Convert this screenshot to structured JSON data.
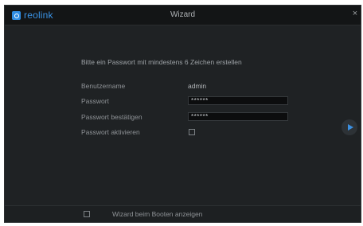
{
  "titlebar": {
    "logo_text": "reolink",
    "title": "Wizard",
    "close_symbol": "×"
  },
  "form": {
    "instruction": "Bitte ein Passwort mit mindestens 6 Zeichen erstellen",
    "username_label": "Benutzername",
    "username_value": "admin",
    "password_label": "Passwort",
    "password_value": "******",
    "confirm_label": "Passwort bestätigen",
    "confirm_value": "******",
    "enable_label": "Passwort aktivieren",
    "enable_checked": false
  },
  "footer": {
    "show_on_boot_label": "Wizard beim Booten anzeigen",
    "show_on_boot_checked": false
  },
  "colors": {
    "accent": "#3a93e6",
    "background": "#1f2224"
  },
  "icons": {
    "next": "play-arrow-icon",
    "close": "close-icon",
    "logo": "reolink-logo"
  }
}
